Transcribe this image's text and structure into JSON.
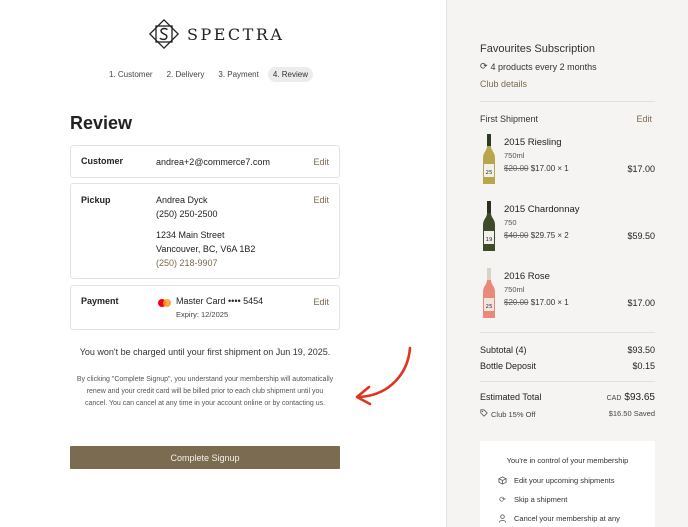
{
  "brand": {
    "name": "SPECTRA"
  },
  "steps": [
    {
      "label": "1. Customer",
      "active": false
    },
    {
      "label": "2. Delivery",
      "active": false
    },
    {
      "label": "3. Payment",
      "active": false
    },
    {
      "label": "4. Review",
      "active": true
    }
  ],
  "review": {
    "title": "Review",
    "customer": {
      "label": "Customer",
      "email": "andrea+2@commerce7.com",
      "edit": "Edit"
    },
    "pickup": {
      "label": "Pickup",
      "name": "Andrea Dyck",
      "phone": "(250) 250-2500",
      "address1": "1234 Main Street",
      "address2": "Vancouver, BC, V6A 1B2",
      "store_phone": "(250) 218-9907",
      "edit": "Edit"
    },
    "payment": {
      "label": "Payment",
      "card": "Master Card •••• 5454",
      "expiry": "Expiry: 12/2025",
      "edit": "Edit"
    },
    "notice": "You won't be charged until your first shipment on Jun 19, 2025.",
    "legal": "By clicking \"Complete Signup\", you understand your membership will automatically renew and your credit card will be billed prior to each club shipment until you cancel. You can cancel at any time in your account online or by contacting us.",
    "cta": "Complete Signup"
  },
  "summary": {
    "title": "Favourites Subscription",
    "frequency": "4 products every 2 months",
    "details_link": "Club details",
    "first_shipment": "First Shipment",
    "edit": "Edit",
    "products": [
      {
        "name": "2015 Riesling",
        "size": "750ml",
        "old_price": "$20.00",
        "price": "$17.00 × 1",
        "total": "$17.00",
        "bottle_color": "#b7a64a",
        "label_text": "25"
      },
      {
        "name": "2015 Chardonnay",
        "size": "750",
        "old_price": "$40.00",
        "price": "$29.75 × 2",
        "total": "$59.50",
        "bottle_color": "#3e4a2a",
        "label_text": "19"
      },
      {
        "name": "2016 Rose",
        "size": "750ml",
        "old_price": "$20.00",
        "price": "$17.00 × 1",
        "total": "$17.00",
        "bottle_color": "#e8897a",
        "label_text": "25"
      }
    ],
    "subtotal_label": "Subtotal (4)",
    "subtotal": "$93.50",
    "deposit_label": "Bottle Deposit",
    "deposit": "$0.15",
    "total_label": "Estimated Total",
    "currency": "CAD",
    "total": "$93.65",
    "discount_label": "Club 15% Off",
    "discount": "$16.50 Saved",
    "control": {
      "title": "You're in control of your membership",
      "items": [
        "Edit your upcoming shipments",
        "Skip a shipment",
        "Cancel your membership at any"
      ]
    }
  },
  "colors": {
    "accent": "#7a6a4f",
    "button": "#7b6b51",
    "annotation_arrow": "#e0341e"
  }
}
